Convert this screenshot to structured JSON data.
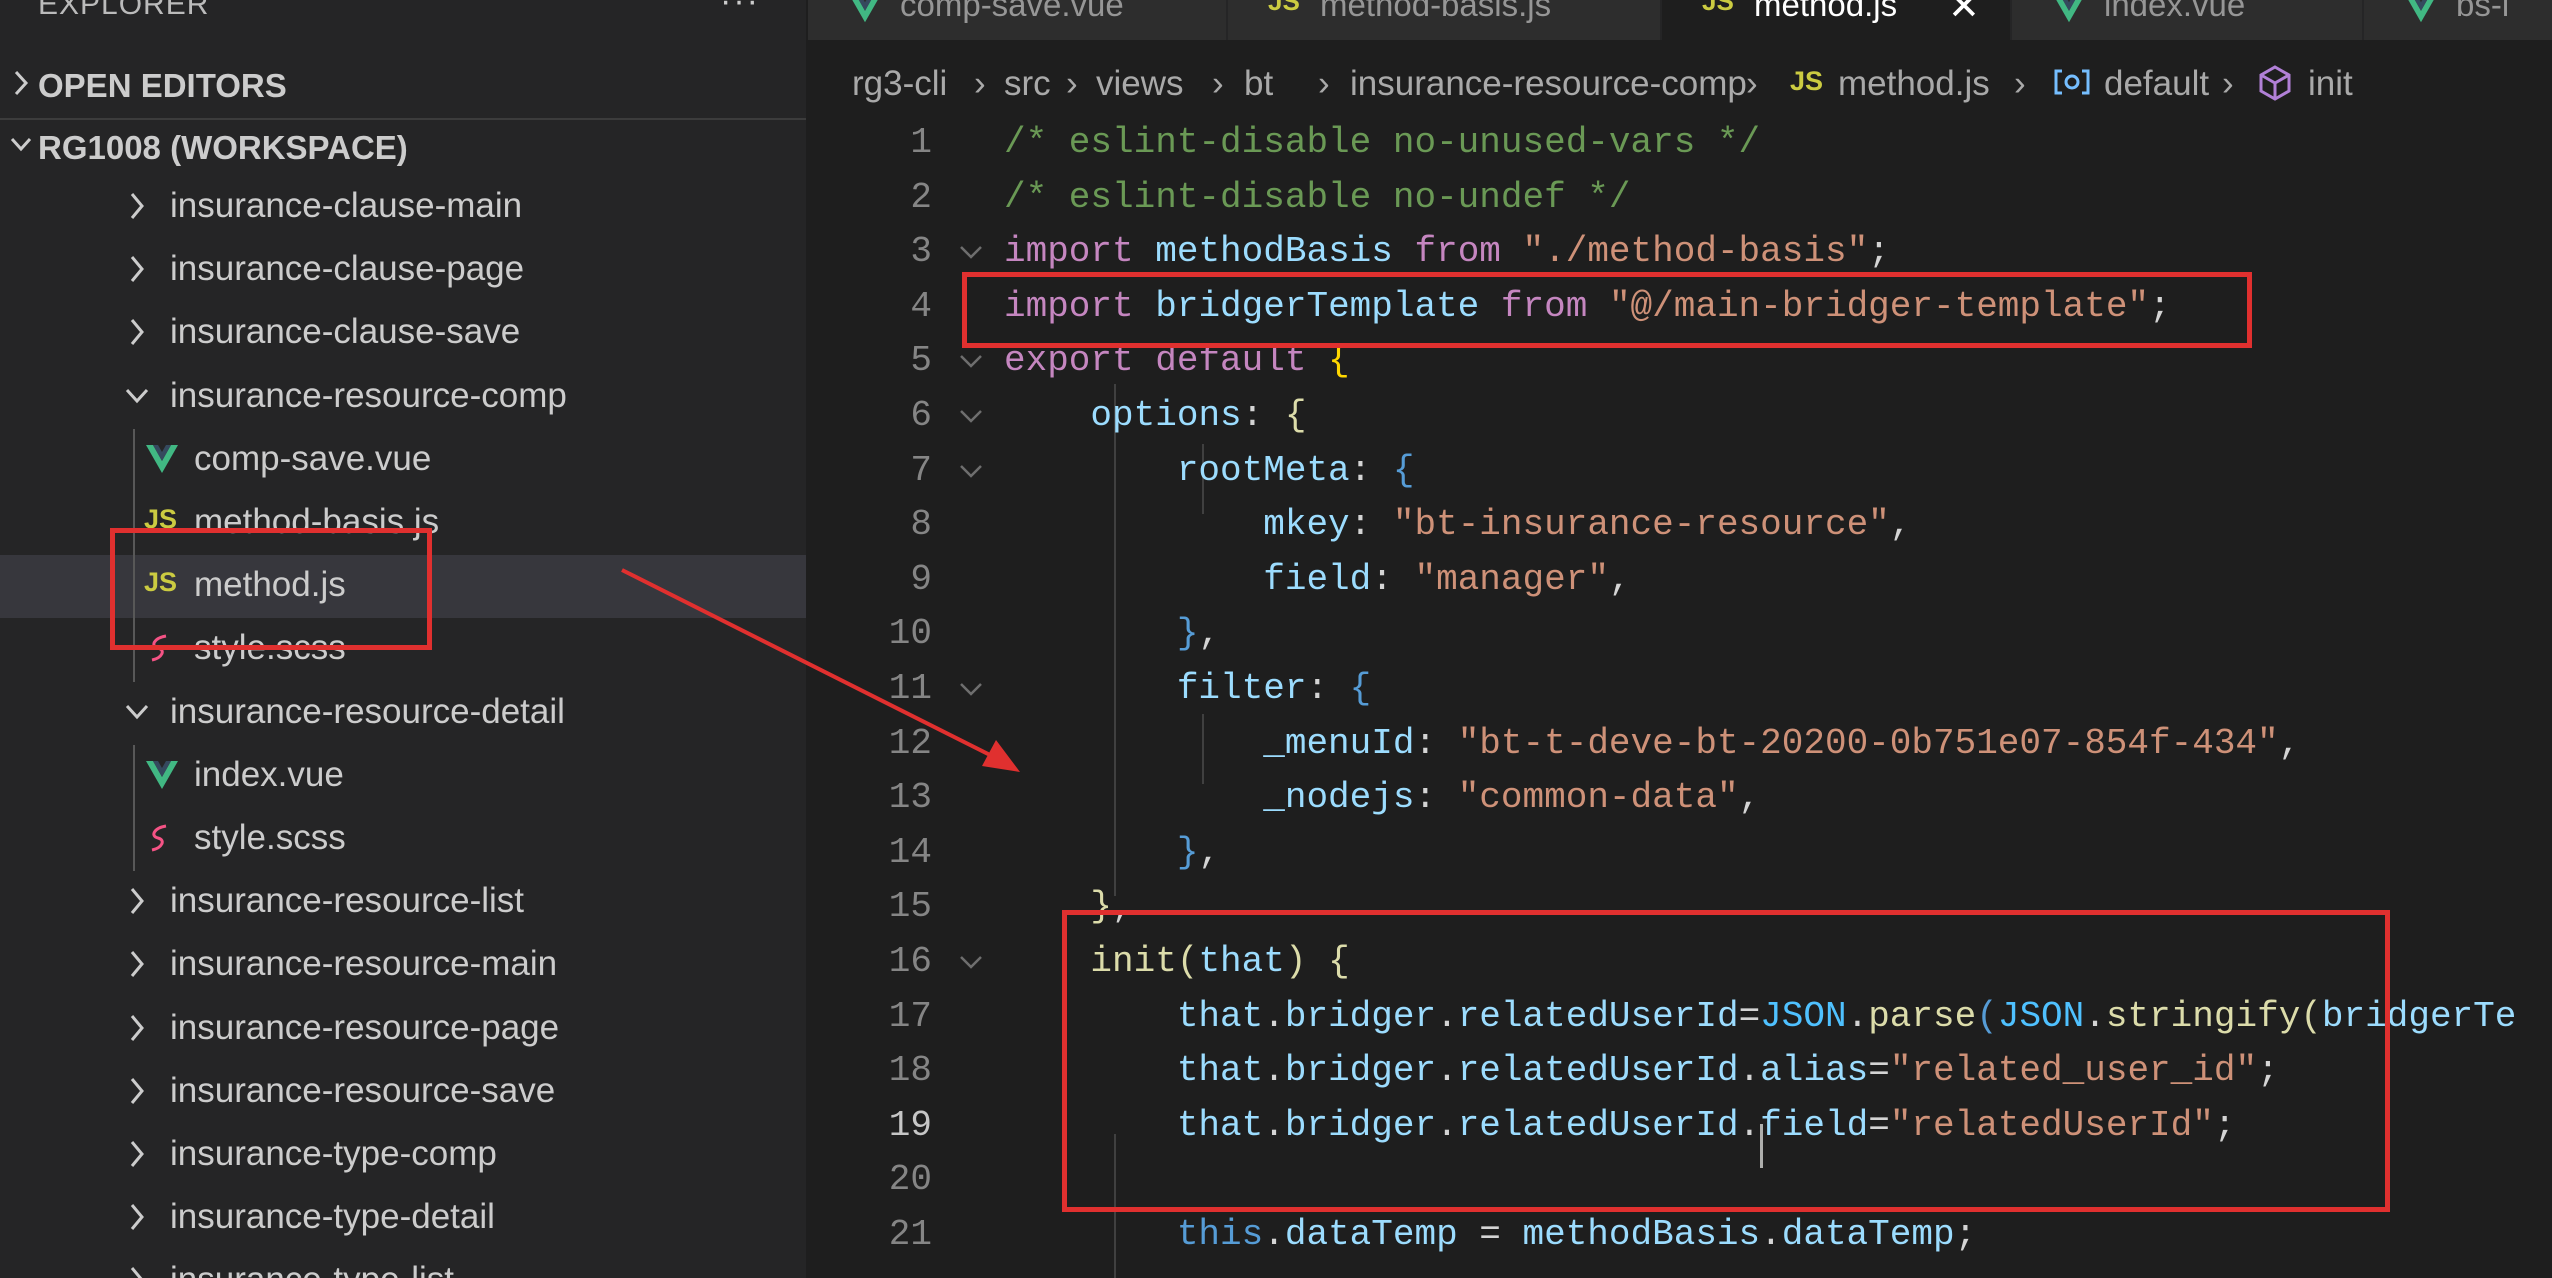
{
  "sidebar": {
    "title": "EXPLORER",
    "more_label": "···",
    "open_editors": "OPEN EDITORS",
    "workspace": "RG1008 (WORKSPACE)",
    "items": [
      {
        "label": "insurance-clause-main",
        "kind": "folder",
        "expanded": false
      },
      {
        "label": "insurance-clause-page",
        "kind": "folder",
        "expanded": false
      },
      {
        "label": "insurance-clause-save",
        "kind": "folder",
        "expanded": false
      },
      {
        "label": "insurance-resource-comp",
        "kind": "folder",
        "expanded": true
      },
      {
        "label": "comp-save.vue",
        "kind": "vue"
      },
      {
        "label": "method-basis.js",
        "kind": "js"
      },
      {
        "label": "method.js",
        "kind": "js",
        "selected": true
      },
      {
        "label": "style.scss",
        "kind": "scss"
      },
      {
        "label": "insurance-resource-detail",
        "kind": "folder",
        "expanded": true
      },
      {
        "label": "index.vue",
        "kind": "vue"
      },
      {
        "label": "style.scss",
        "kind": "scss"
      },
      {
        "label": "insurance-resource-list",
        "kind": "folder",
        "expanded": false
      },
      {
        "label": "insurance-resource-main",
        "kind": "folder",
        "expanded": false
      },
      {
        "label": "insurance-resource-page",
        "kind": "folder",
        "expanded": false
      },
      {
        "label": "insurance-resource-save",
        "kind": "folder",
        "expanded": false
      },
      {
        "label": "insurance-type-comp",
        "kind": "folder",
        "expanded": false
      },
      {
        "label": "insurance-type-detail",
        "kind": "folder",
        "expanded": false
      },
      {
        "label": "insurance-type-list",
        "kind": "folder",
        "expanded": false
      }
    ]
  },
  "tabs": [
    {
      "label": "comp-save.vue",
      "icon": "V",
      "icon_name": "vue-icon"
    },
    {
      "label": "method-basis.js",
      "icon": "JS",
      "icon_name": "js-icon"
    },
    {
      "label": "method.js",
      "icon": "JS",
      "icon_name": "js-icon",
      "active": true,
      "close": "✕"
    },
    {
      "label": "index.vue",
      "icon": "V",
      "icon_name": "vue-icon"
    },
    {
      "label": "bs-i",
      "icon": "V",
      "icon_name": "vue-icon"
    }
  ],
  "breadcrumb": {
    "parts": [
      "rg3-cli",
      "src",
      "views",
      "bt",
      "insurance-resource-comp"
    ],
    "file_icon": "JS",
    "file": "method.js",
    "symbol1": "default",
    "symbol2": "init",
    "separator": "›"
  },
  "editor": {
    "current_line": 19,
    "lines": [
      {
        "n": "1",
        "t": [
          [
            "c-comment",
            "/* eslint-disable no-unused-vars */"
          ]
        ]
      },
      {
        "n": "2",
        "t": [
          [
            "c-comment",
            "/* eslint-disable no-undef */"
          ]
        ]
      },
      {
        "n": "3",
        "fold": true,
        "t": [
          [
            "c-kw",
            "import"
          ],
          [
            "c-punc",
            " "
          ],
          [
            "c-var",
            "methodBasis"
          ],
          [
            "c-punc",
            " "
          ],
          [
            "c-kw",
            "from"
          ],
          [
            "c-punc",
            " "
          ],
          [
            "c-str",
            "\"./method-basis\""
          ],
          [
            "c-punc",
            ";"
          ]
        ]
      },
      {
        "n": "4",
        "t": [
          [
            "c-kw",
            "import"
          ],
          [
            "c-punc",
            " "
          ],
          [
            "c-var",
            "bridgerTemplate"
          ],
          [
            "c-punc",
            " "
          ],
          [
            "c-kw",
            "from"
          ],
          [
            "c-punc",
            " "
          ],
          [
            "c-str",
            "\"@/main-bridger-template\""
          ],
          [
            "c-punc",
            ";"
          ]
        ]
      },
      {
        "n": "5",
        "fold": true,
        "t": [
          [
            "c-kw",
            "export"
          ],
          [
            "c-punc",
            " "
          ],
          [
            "c-kw",
            "default"
          ],
          [
            "c-punc",
            " "
          ],
          [
            "c-brace",
            "{"
          ]
        ]
      },
      {
        "n": "6",
        "fold": true,
        "t": [
          [
            "c-punc",
            "    "
          ],
          [
            "c-var",
            "options"
          ],
          [
            "c-punc",
            ": "
          ],
          [
            "c-fn",
            "{"
          ]
        ]
      },
      {
        "n": "7",
        "fold": true,
        "t": [
          [
            "c-punc",
            "        "
          ],
          [
            "c-var",
            "rootMeta"
          ],
          [
            "c-punc",
            ": "
          ],
          [
            "c-this",
            "{"
          ]
        ]
      },
      {
        "n": "8",
        "t": [
          [
            "c-punc",
            "            "
          ],
          [
            "c-var",
            "mkey"
          ],
          [
            "c-punc",
            ": "
          ],
          [
            "c-str",
            "\"bt-insurance-resource\""
          ],
          [
            "c-punc",
            ","
          ]
        ]
      },
      {
        "n": "9",
        "t": [
          [
            "c-punc",
            "            "
          ],
          [
            "c-var",
            "field"
          ],
          [
            "c-punc",
            ": "
          ],
          [
            "c-str",
            "\"manager\""
          ],
          [
            "c-punc",
            ","
          ]
        ]
      },
      {
        "n": "10",
        "t": [
          [
            "c-punc",
            "        "
          ],
          [
            "c-this",
            "}"
          ],
          [
            "c-punc",
            ","
          ]
        ]
      },
      {
        "n": "11",
        "fold": true,
        "t": [
          [
            "c-punc",
            "        "
          ],
          [
            "c-var",
            "filter"
          ],
          [
            "c-punc",
            ": "
          ],
          [
            "c-this",
            "{"
          ]
        ]
      },
      {
        "n": "12",
        "t": [
          [
            "c-punc",
            "            "
          ],
          [
            "c-var",
            "_menuId"
          ],
          [
            "c-punc",
            ": "
          ],
          [
            "c-str",
            "\"bt-t-deve-bt-20200-0b751e07-854f-434\""
          ],
          [
            "c-punc",
            ","
          ]
        ]
      },
      {
        "n": "13",
        "t": [
          [
            "c-punc",
            "            "
          ],
          [
            "c-var",
            "_nodejs"
          ],
          [
            "c-punc",
            ": "
          ],
          [
            "c-str",
            "\"common-data\""
          ],
          [
            "c-punc",
            ","
          ]
        ]
      },
      {
        "n": "14",
        "t": [
          [
            "c-punc",
            "        "
          ],
          [
            "c-this",
            "}"
          ],
          [
            "c-punc",
            ","
          ]
        ]
      },
      {
        "n": "15",
        "t": [
          [
            "c-punc",
            "    "
          ],
          [
            "c-fn",
            "}"
          ],
          [
            "c-punc",
            ","
          ]
        ]
      },
      {
        "n": "16",
        "fold": true,
        "t": [
          [
            "c-punc",
            "    "
          ],
          [
            "c-fn",
            "init"
          ],
          [
            "c-fn",
            "("
          ],
          [
            "c-var",
            "that"
          ],
          [
            "c-fn",
            ")"
          ],
          [
            "c-punc",
            " "
          ],
          [
            "c-fn",
            "{"
          ]
        ]
      },
      {
        "n": "17",
        "t": [
          [
            "c-punc",
            "        "
          ],
          [
            "c-var",
            "that"
          ],
          [
            "c-punc",
            "."
          ],
          [
            "c-var",
            "bridger"
          ],
          [
            "c-punc",
            "."
          ],
          [
            "c-var",
            "relatedUserId"
          ],
          [
            "c-punc",
            "="
          ],
          [
            "c-cls",
            "JSON"
          ],
          [
            "c-punc",
            "."
          ],
          [
            "c-fn",
            "parse"
          ],
          [
            "c-this",
            "("
          ],
          [
            "c-cls",
            "JSON"
          ],
          [
            "c-punc",
            "."
          ],
          [
            "c-fn",
            "stringify"
          ],
          [
            "c-fn",
            "("
          ],
          [
            "c-var",
            "bridgerTe"
          ]
        ]
      },
      {
        "n": "18",
        "t": [
          [
            "c-punc",
            "        "
          ],
          [
            "c-var",
            "that"
          ],
          [
            "c-punc",
            "."
          ],
          [
            "c-var",
            "bridger"
          ],
          [
            "c-punc",
            "."
          ],
          [
            "c-var",
            "relatedUserId"
          ],
          [
            "c-punc",
            "."
          ],
          [
            "c-var",
            "alias"
          ],
          [
            "c-punc",
            "="
          ],
          [
            "c-str",
            "\"related_user_id\""
          ],
          [
            "c-punc",
            ";"
          ]
        ]
      },
      {
        "n": "19",
        "t": [
          [
            "c-punc",
            "        "
          ],
          [
            "c-var",
            "that"
          ],
          [
            "c-punc",
            "."
          ],
          [
            "c-var",
            "bridger"
          ],
          [
            "c-punc",
            "."
          ],
          [
            "c-var",
            "relatedUserId"
          ],
          [
            "c-punc",
            "."
          ],
          [
            "c-var",
            "field"
          ],
          [
            "c-punc",
            "="
          ],
          [
            "c-str",
            "\"relatedUserId\""
          ],
          [
            "c-punc",
            ";"
          ]
        ]
      },
      {
        "n": "20",
        "t": []
      },
      {
        "n": "21",
        "t": [
          [
            "c-punc",
            "        "
          ],
          [
            "c-this",
            "this"
          ],
          [
            "c-punc",
            "."
          ],
          [
            "c-var",
            "dataTemp"
          ],
          [
            "c-punc",
            " = "
          ],
          [
            "c-var",
            "methodBasis"
          ],
          [
            "c-punc",
            "."
          ],
          [
            "c-var",
            "dataTemp"
          ],
          [
            "c-punc",
            ";"
          ]
        ]
      }
    ]
  },
  "annotation": {
    "color": "#e0302f"
  }
}
